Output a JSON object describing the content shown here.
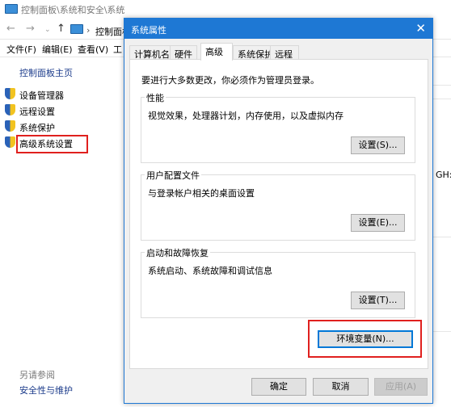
{
  "window": {
    "title": "控制面板\\系统和安全\\系统",
    "breadcrumb": "控制面板",
    "menu": [
      "文件(F)",
      "编辑(E)",
      "查看(V)",
      "工"
    ],
    "home": "控制面板主页",
    "links": [
      "设备管理器",
      "远程设置",
      "系统保护",
      "高级系统设置"
    ],
    "see_also": "另请参阅",
    "security_link": "安全性与维护",
    "partial_text": "GH:"
  },
  "dialog": {
    "title": "系统属性",
    "tabs": [
      "计算机名",
      "硬件",
      "高级",
      "系统保护",
      "远程"
    ],
    "active_tab": "高级",
    "admin_note": "要进行大多数更改，你必须作为管理员登录。",
    "groups": [
      {
        "label": "性能",
        "desc": "视觉效果，处理器计划，内存使用，以及虚拟内存",
        "button": "设置(S)..."
      },
      {
        "label": "用户配置文件",
        "desc": "与登录帐户相关的桌面设置",
        "button": "设置(E)..."
      },
      {
        "label": "启动和故障恢复",
        "desc": "系统启动、系统故障和调试信息",
        "button": "设置(T)..."
      }
    ],
    "env_button": "环境变量(N)...",
    "ok": "确定",
    "cancel": "取消",
    "apply": "应用(A)"
  },
  "colors": {
    "titlebar": "#1e78d4",
    "highlight": "#e0201e"
  }
}
